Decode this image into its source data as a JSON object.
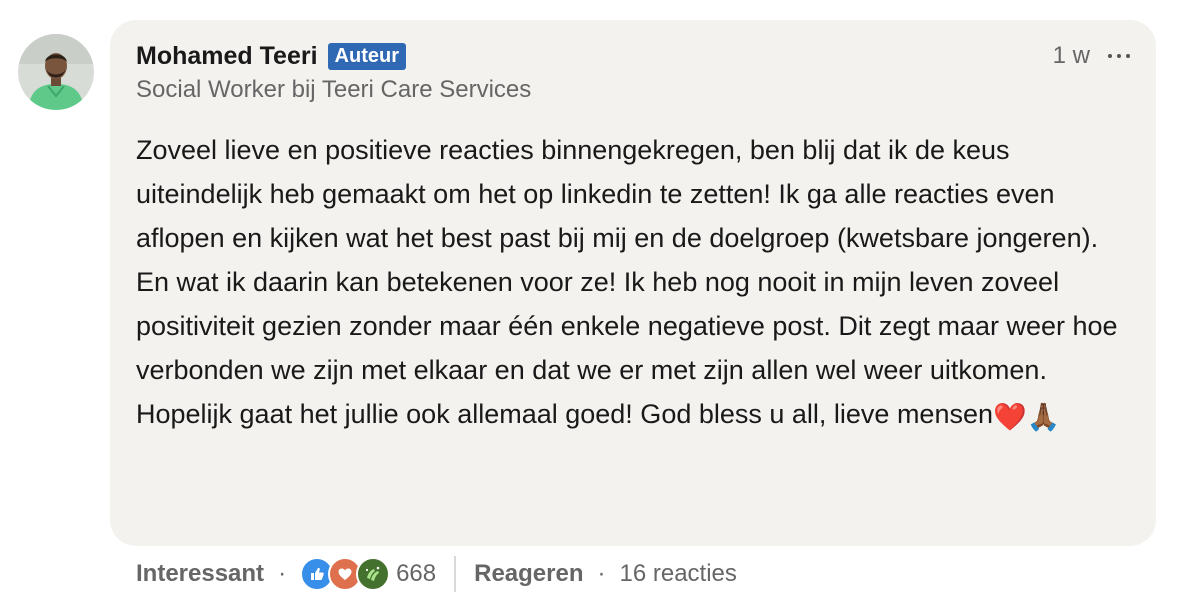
{
  "comment": {
    "author": {
      "name": "Mohamed Teeri",
      "badge": "Auteur",
      "headline": "Social Worker bij Teeri Care Services"
    },
    "timestamp": "1 w",
    "more_icon": "ellipsis-icon",
    "text": "Zoveel lieve en positieve reacties binnengekregen, ben blij dat ik de keus uiteindelijk heb gemaakt om het op linkedin te zetten! Ik ga alle reacties even aflopen en kijken wat het best past bij mij en de doelgroep (kwetsbare jongeren). En wat ik daarin kan betekenen voor ze! Ik heb nog nooit in mijn leven zoveel positiviteit gezien zonder maar één enkele negatieve post. Dit zegt maar weer hoe verbonden we zijn met elkaar en dat we er met zijn allen wel weer uitkomen. Hopelijk gaat het jullie ook allemaal goed! God bless u all, lieve mensen",
    "text_emojis": [
      "❤️",
      "🙏🏾"
    ]
  },
  "actions": {
    "react_label": "Interessant",
    "separator": "·",
    "reaction_icons": [
      "like-icon",
      "love-icon",
      "celebrate-icon"
    ],
    "reaction_count": "668",
    "reply_label": "Reageren",
    "reply_count": "16 reacties"
  },
  "colors": {
    "bubble_bg": "#f3f2ef",
    "badge_bg": "#2f68b3",
    "like": "#378fe9",
    "love": "#df704d",
    "celebrate": "#44712e"
  }
}
